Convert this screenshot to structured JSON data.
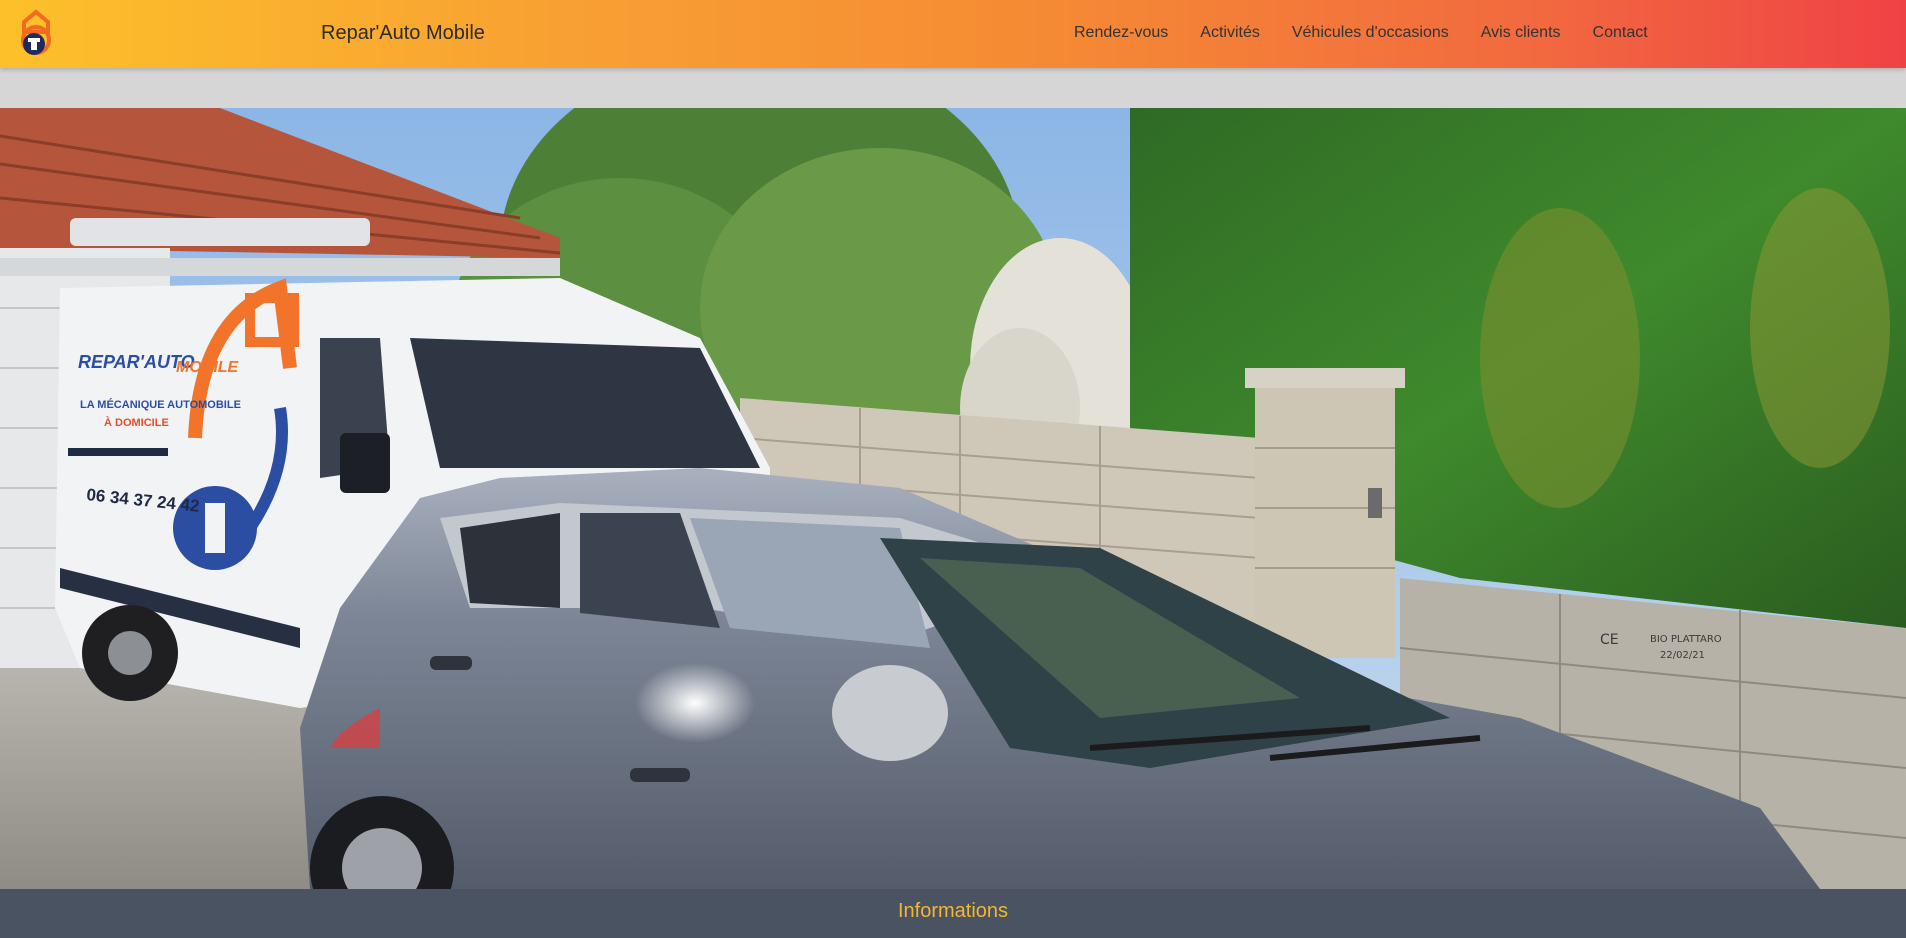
{
  "header": {
    "brand": "Repar'Auto Mobile",
    "logo_icon": "wrench-house-logo-icon",
    "nav": [
      {
        "label": "Rendez-vous"
      },
      {
        "label": "Activités"
      },
      {
        "label": "Véhicules d'occasions"
      },
      {
        "label": "Avis clients"
      },
      {
        "label": "Contact"
      }
    ]
  },
  "hero": {
    "van_brand_line1": "REPAR'AUTO",
    "van_brand_line2": "MOBILE",
    "van_tagline_1": "LA MÉCANIQUE AUTOMOBILE",
    "van_tagline_2": "À DOMICILE",
    "van_phone": "06 34 37 24 42",
    "wall_stamp_1": "CE",
    "wall_stamp_2": "BIO PLATTARO",
    "wall_stamp_3": "22/02/21"
  },
  "footer_bar": {
    "title": "Informations"
  },
  "colors": {
    "gradient_start": "#fdc02a",
    "gradient_end": "#ef4245",
    "info_bar_bg": "#4a5361",
    "info_title": "#f5b52e"
  }
}
